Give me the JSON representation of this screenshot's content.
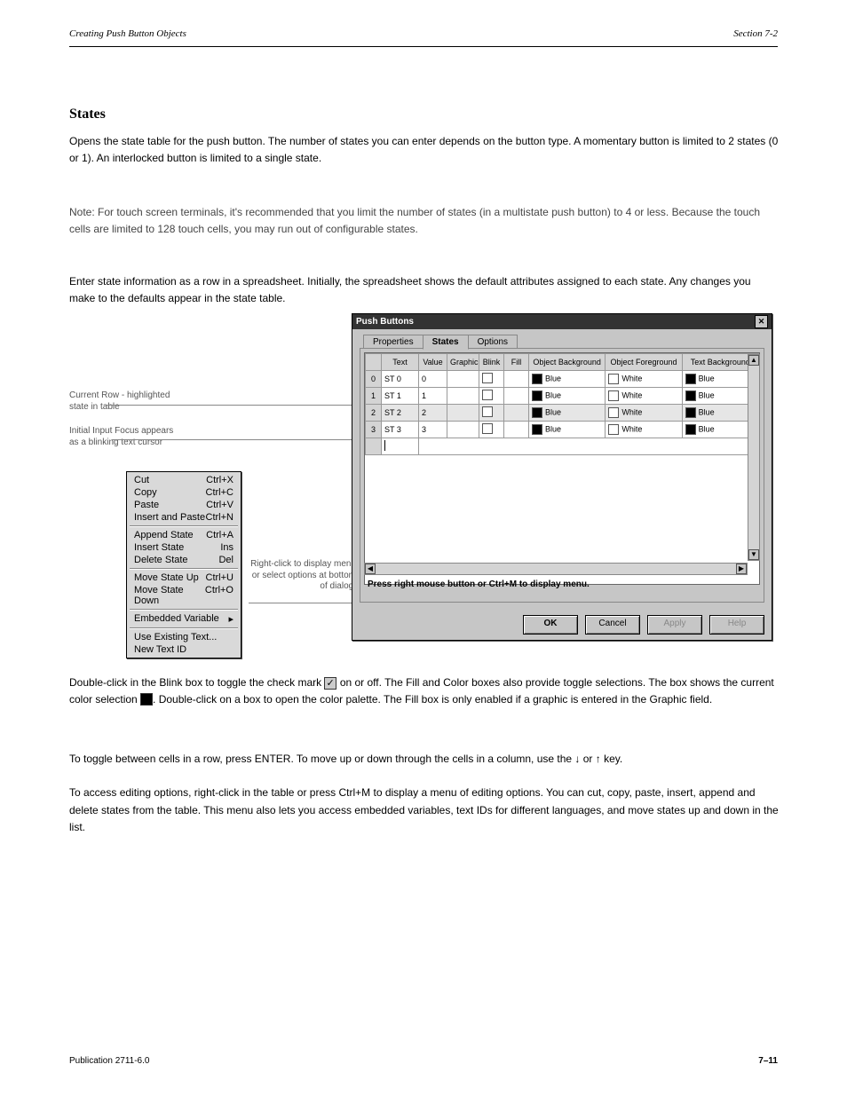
{
  "page": {
    "header_left": "Creating Push Button Objects",
    "header_right": "Section 7-2",
    "publication": "Publication 2711-6.0",
    "page_number": "7–11"
  },
  "section": {
    "title": "States",
    "para1": "Opens the state table for the push button. The number of states you can enter depends on the button type. A momentary button is limited to 2 states (0 or 1). An interlocked button is limited to a single state.",
    "para2": "Note: For touch screen terminals, it's recommended that you limit the number of states (in a multistate push button) to 4 or less. Because the touch cells are limited to 128 touch cells, you may run out of configurable states.",
    "para3": "Enter state information as a row in a spreadsheet. Initially, the spreadsheet shows the default attributes assigned to each state. Any changes you make to the defaults appear in the state table."
  },
  "callouts": {
    "current_row": "Current Row - highlighted state in table",
    "initial_input": "Initial Input Focus appears as a blinking text cursor",
    "right_click": "Right-click to display menu or select options at bottom of dialog."
  },
  "context_menu": {
    "items": [
      {
        "label": "Cut",
        "short": "Ctrl+X"
      },
      {
        "label": "Copy",
        "short": "Ctrl+C"
      },
      {
        "label": "Paste",
        "short": "Ctrl+V"
      },
      {
        "label": "Insert and Paste",
        "short": "Ctrl+N"
      },
      {
        "sep": true
      },
      {
        "label": "Append State",
        "short": "Ctrl+A"
      },
      {
        "label": "Insert State",
        "short": "Ins"
      },
      {
        "label": "Delete State",
        "short": "Del"
      },
      {
        "sep": true
      },
      {
        "label": "Move State Up",
        "short": "Ctrl+U"
      },
      {
        "label": "Move State Down",
        "short": "Ctrl+O"
      },
      {
        "sep": true
      },
      {
        "label": "Embedded Variable",
        "short": "▸"
      },
      {
        "sep": true
      },
      {
        "label": "Use Existing Text...",
        "short": ""
      },
      {
        "label": "New Text ID",
        "short": ""
      }
    ]
  },
  "dialog": {
    "title": "Push Buttons",
    "tabs": [
      "Properties",
      "States",
      "Options"
    ],
    "active_tab": "States",
    "columns": [
      "",
      "Text",
      "Value",
      "Graphic",
      "Blink",
      "Fill",
      "Object Background",
      "Object Foreground",
      "Text Background"
    ],
    "rows": [
      {
        "n": "0",
        "text": "ST 0",
        "value": "0",
        "obg": "Blue",
        "ofg": "White",
        "tbg": "Blue"
      },
      {
        "n": "1",
        "text": "ST 1",
        "value": "1",
        "obg": "Blue",
        "ofg": "White",
        "tbg": "Blue"
      },
      {
        "n": "2",
        "text": "ST 2",
        "value": "2",
        "obg": "Blue",
        "ofg": "White",
        "tbg": "Blue"
      },
      {
        "n": "3",
        "text": "ST 3",
        "value": "3",
        "obg": "Blue",
        "ofg": "White",
        "tbg": "Blue"
      }
    ],
    "hint": "Press right mouse button or Ctrl+M to display menu.",
    "buttons": {
      "ok": "OK",
      "cancel": "Cancel",
      "apply": "Apply",
      "help": "Help"
    }
  },
  "footer": {
    "para1_a": "Double-click in the Blink box to toggle the check mark ",
    "para1_b": " on or off. The Fill and Color boxes also provide toggle selections. The box shows the current color selection ",
    "para1_c": ". Double-click on a box to open the color palette. The Fill box is only enabled if a graphic is entered in the Graphic field.",
    "toggle": "To toggle between cells in a row, press ENTER. To move up or down through the cells in a column, use the ↓ or ↑ key.\n\nTo access editing options, right-click in the table or press Ctrl+M to display a menu of editing options. You can cut, copy, paste, insert, append and delete states from the table. This menu also lets you access embedded variables, text IDs for different languages, and move states up and down in the list."
  }
}
